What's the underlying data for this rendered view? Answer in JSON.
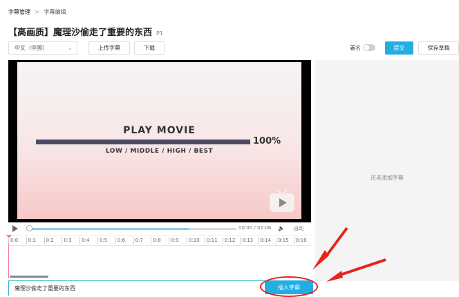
{
  "breadcrumb": {
    "parent": "字幕管理",
    "separator": ">",
    "current": "字幕编辑"
  },
  "page": {
    "title": "【高画质】魔理沙偷走了重要的东西",
    "part": "P1"
  },
  "toolbar": {
    "language_value": "中文（中国）",
    "upload_label": "上传字幕",
    "download_label": "下载",
    "signature_label": "署名",
    "submit_label": "提交",
    "save_draft_label": "保存草稿"
  },
  "video": {
    "splash_title": "PLAY MOVIE",
    "load_percent_text": "100%",
    "load_progress": 1.0,
    "quality_text": "LOW / MIDDLE / HIGH / BEST"
  },
  "player": {
    "time_text": "00:00 / 02:08",
    "progress": 0.77,
    "auto_label": "自动"
  },
  "timeline": {
    "ticks": [
      "0:0",
      "0:1",
      "0:2",
      "0:3",
      "0:4",
      "0:5",
      "0:6",
      "0:7",
      "0:8",
      "0:9",
      "0:10",
      "0:11",
      "0:12",
      "0:13",
      "0:14",
      "0:15",
      "0:16"
    ]
  },
  "subtitle_panel": {
    "empty_text": "还未添加字幕"
  },
  "subtitle_input": {
    "value": "魔理沙偷走了重要的东西"
  },
  "insert": {
    "label": "插入字幕"
  },
  "colors": {
    "accent": "#23ade5",
    "annotation": "#e8231a",
    "playhead": "#f2779b"
  }
}
